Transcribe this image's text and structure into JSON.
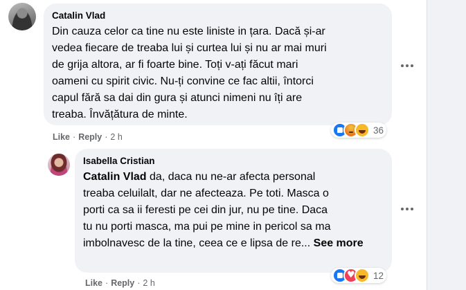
{
  "comments": [
    {
      "author": "Catalin Vlad",
      "lines": [
        "Din cauza celor ca tine nu este liniste in țara. Dacă și-ar",
        "vedea fiecare de treaba lui și curtea lui și nu ar mai muri",
        "de grija altora, ar fi foarte bine. Toți v-ați făcut mari",
        "oameni cu spirit civic. Nu-ți convine ce fac altii, întorci",
        "capul fără sa dai din gura și atunci nimeni nu îți are",
        "treaba. Învățătura de minte."
      ],
      "actions": {
        "like": "Like",
        "reply": "Reply",
        "sep": "·",
        "time": "2 h"
      },
      "reactions": {
        "icons": [
          "like-icon",
          "angry-icon",
          "haha-icon"
        ],
        "count": "36"
      }
    },
    {
      "author": "Isabella Cristian",
      "mention": "Catalin Vlad",
      "lines": [
        " da, daca nu ne-ar afecta personal",
        "treaba celuilalt, dar ne afecteaza. Pe toti. Masca o",
        "porti ca sa ii feresti pe cei din jur, nu pe tine. Daca",
        "tu nu porti masca, ma pui pe mine in pericol sa ma",
        "imbolnavesc de la tine, ceea ce e lipsa de re... "
      ],
      "see_more": "See more",
      "actions": {
        "like": "Like",
        "reply": "Reply",
        "sep": "·",
        "time": "2 h"
      },
      "reactions": {
        "icons": [
          "like-icon",
          "love-icon",
          "haha-icon"
        ],
        "count": "12"
      }
    }
  ]
}
